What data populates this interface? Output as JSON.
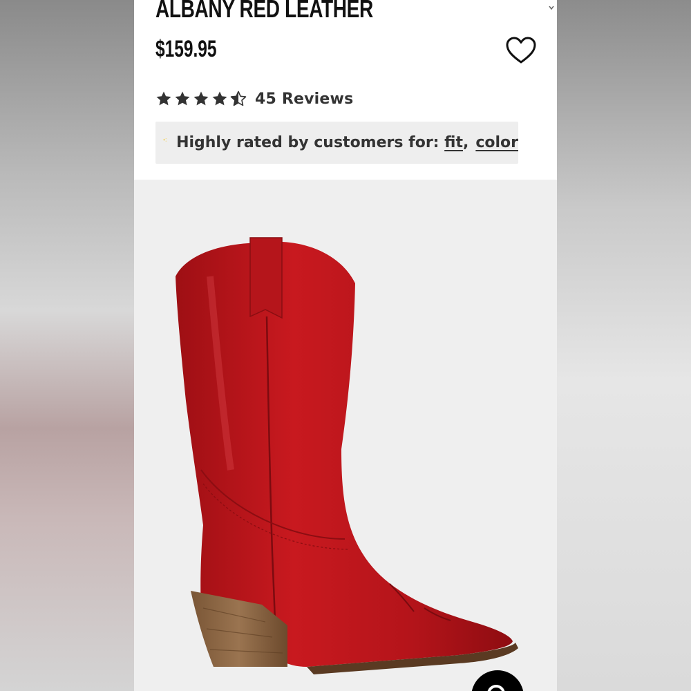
{
  "product": {
    "title": "ALBANY RED LEATHER",
    "price": "$159.95"
  },
  "rating": {
    "value": 4.5,
    "max": 5,
    "review_count_label": "45 Reviews"
  },
  "highlights": {
    "prefix": "Highly rated by customers for:",
    "attributes": [
      "fit",
      "color"
    ]
  },
  "icons": {
    "wishlist": "heart-outline-icon",
    "star": "star-icon",
    "sparkle": "sparkle-icon",
    "zoom": "zoom-icon"
  },
  "colors": {
    "star": "#333333",
    "sparkle": "#f5c518",
    "highlight_bg": "#eeeeee",
    "boot": "#c0171d",
    "heel": "#8a6543"
  }
}
